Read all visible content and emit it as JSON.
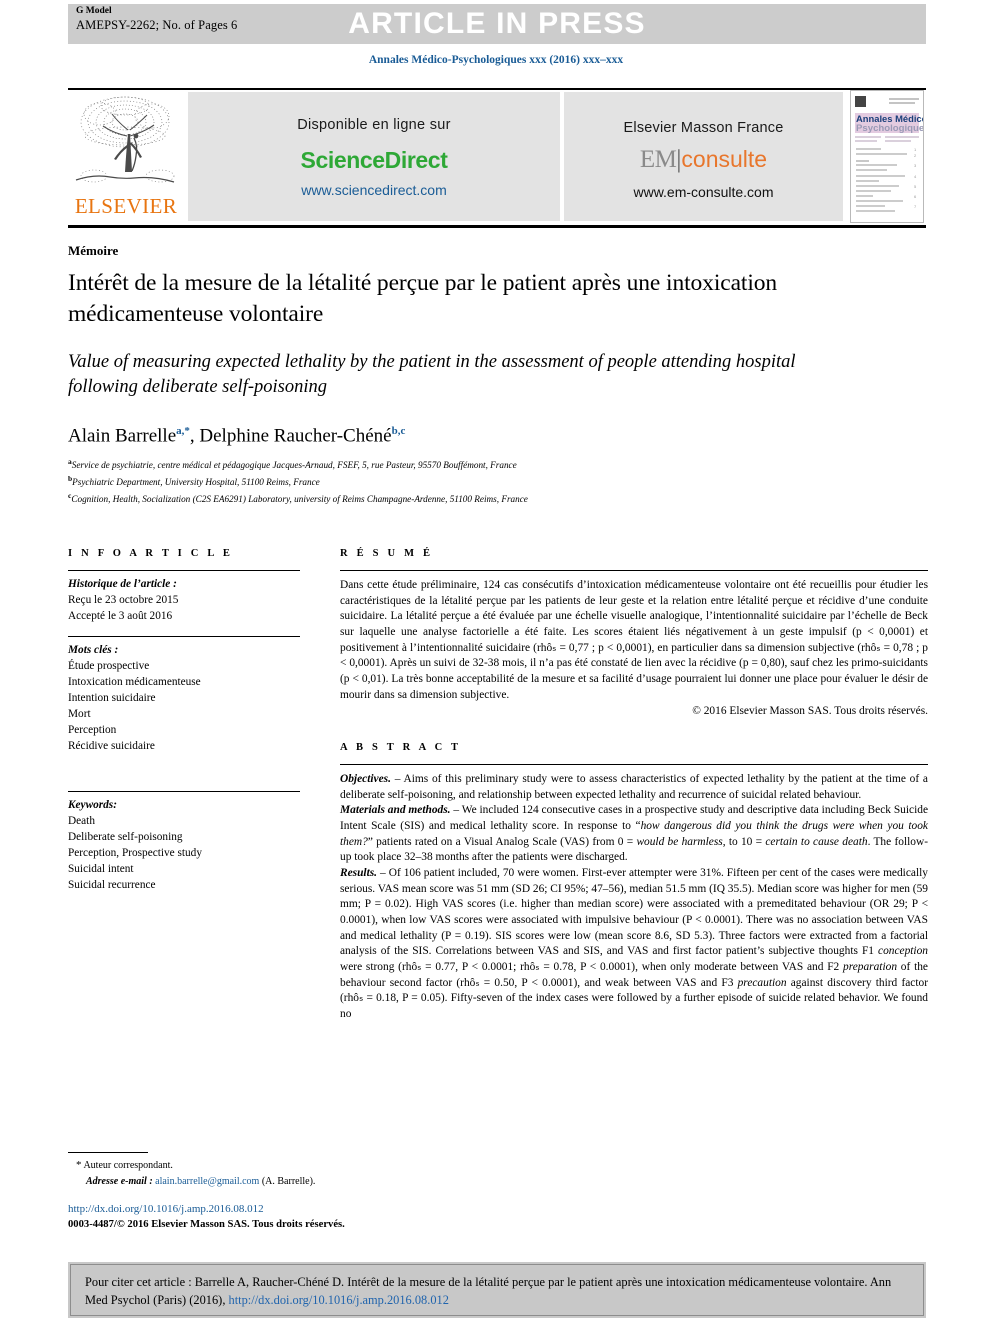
{
  "header": {
    "g_model": "G Model",
    "manuscript_id": "AMEPSY-2262; No. of Pages 6",
    "press_banner": "ARTICLE IN PRESS",
    "journal_running": "Annales Médico-Psychologiques xxx (2016) xxx–xxx"
  },
  "masthead": {
    "publisher_logo_word": "ELSEVIER",
    "sciencedirect": {
      "available_label": "Disponible en ligne sur",
      "brand": "ScienceDirect",
      "url": "www.sciencedirect.com"
    },
    "emconsulte": {
      "imprint": "Elsevier Masson France",
      "brand_em": "EM",
      "brand_divider": "|",
      "brand_consulte": "consulte",
      "url": "www.em-consulte.com"
    },
    "cover": {
      "title_line1": "Annales Médico",
      "title_line2": "Psychologiques"
    }
  },
  "article": {
    "section_label": "Mémoire",
    "title_fr": "Intérêt de la mesure de la létalité perçue par le patient après une intoxication médicamenteuse volontaire",
    "title_en": "Value of measuring expected lethality by the patient in the assessment of people attending hospital following deliberate self-poisoning",
    "authors": [
      {
        "name": "Alain Barrelle",
        "marks": "a,*"
      },
      {
        "name": "Delphine Raucher-Chéné",
        "marks": "b,c"
      }
    ],
    "affiliations": [
      {
        "mark": "a",
        "text": "Service de psychiatrie, centre médical et pédagogique Jacques-Arnaud, FSEF, 5, rue Pasteur, 95570 Bouffémont, France"
      },
      {
        "mark": "b",
        "text": "Psychiatric Department, University Hospital, 51100 Reims, France"
      },
      {
        "mark": "c",
        "text": "Cognition, Health, Socialization (C2S EA6291) Laboratory, university of Reims Champagne-Ardenne, 51100 Reims, France"
      }
    ]
  },
  "info_article": {
    "heading": "I N F O   A R T I C L E",
    "history_label": "Historique de l’article :",
    "history": [
      "Reçu le 23 octobre 2015",
      "Accepté le 3 août 2016"
    ],
    "keywords_label": "Mots clés :",
    "keywords": [
      "Étude prospective",
      "Intoxication médicamenteuse",
      "Intention suicidaire",
      "Mort",
      "Perception",
      "Récidive suicidaire"
    ],
    "keywords_en_label": "Keywords:",
    "keywords_en": [
      "Death",
      "Deliberate self-poisoning",
      "Perception, Prospective study",
      "Suicidal intent",
      "Suicidal recurrence"
    ]
  },
  "resume": {
    "heading": "R É S U M É",
    "body": "Dans cette étude préliminaire, 124 cas consécutifs d’intoxication médicamenteuse volontaire ont été recueillis pour étudier les caractéristiques de la létalité perçue par les patients de leur geste et la relation entre létalité perçue et récidive d’une conduite suicidaire. La létalité perçue a été évaluée par une échelle visuelle analogique, l’intentionnalité suicidaire par l’échelle de Beck sur laquelle une analyse factorielle a été faite. Les scores étaient liés négativement à un geste impulsif (p < 0,0001) et positivement à l’intentionnalité suicidaire (rhôₛ = 0,77 ; p < 0,0001), en particulier dans sa dimension subjective (rhôₛ = 0,78 ; p < 0,0001). Après un suivi de 32-38 mois, il n’a pas été constaté de lien avec la récidive (p = 0,80), sauf chez les primo-suicidants (p < 0,01). La très bonne acceptabilité de la mesure et sa facilité d’usage pourraient lui donner une place pour évaluer le désir de mourir dans sa dimension subjective.",
    "copyright": "© 2016 Elsevier Masson SAS. Tous droits réservés."
  },
  "abstract": {
    "heading": "A B S T R A C T",
    "objectives_label": "Objectives.",
    "objectives": "– Aims of this preliminary study were to assess characteristics of expected lethality by the patient at the time of a deliberate self-poisoning, and relationship between expected lethality and recurrence of suicidal related behaviour.",
    "methods_label": "Materials and methods.",
    "methods_part1": "– We included 124 consecutive cases in a prospective study and descriptive data including Beck Suicide Intent Scale (SIS) and medical lethality score. In response to “",
    "methods_italic1": "how dangerous did you think the drugs were when you took them?",
    "methods_part2": "” patients rated on a Visual Analog Scale (VAS) from 0 = ",
    "methods_italic2": "would be harmless",
    "methods_part3": ", to 10 = ",
    "methods_italic3": "certain to cause death",
    "methods_part4": ". The follow-up took place 32–38 months after the patients were discharged.",
    "results_label": "Results.",
    "results_part1": "– Of 106 patient included, 70 were women. First-ever attempter were 31%. Fifteen per cent of the cases were medically serious. VAS mean score was 51 mm (SD 26; CI 95%; 47–56), median 51.5 mm (IQ 35.5). Median score was higher for men (59 mm; P = 0.02). High VAS scores (i.e. higher than median score) were associated with a premeditated behaviour (OR 29; P < 0.0001), when low VAS scores were associated with impulsive behaviour (P < 0.0001). There was no association between VAS and medical lethality (P = 0.19). SIS scores were low (mean score 8.6, SD 5.3). Three factors were extracted from a factorial analysis of the SIS. Correlations between VAS and SIS, and VAS and first factor patient’s subjective thoughts F1 ",
    "results_italic1": "conception",
    "results_part2": " were strong (rhôₛ = 0.77, P < 0.0001; rhôₛ = 0.78, P < 0.0001), when only moderate between VAS and F2 ",
    "results_italic2": "preparation",
    "results_part3": " of the behaviour second factor (rhôₛ = 0.50, P < 0.0001), and weak between VAS and F3 ",
    "results_italic3": "precaution",
    "results_part4": " against discovery third factor (rhôₛ = 0.18, P = 0.05). Fifty-seven of the index cases were followed by a further episode of suicide related behavior. We found no"
  },
  "footer": {
    "corresponding_marker": "*",
    "corresponding_label": "Auteur correspondant.",
    "email_label": "Adresse e-mail :",
    "email": "alain.barrelle@gmail.com",
    "email_suffix": "(A. Barrelle).",
    "doi_url": "http://dx.doi.org/10.1016/j.amp.2016.08.012",
    "issn_copyright": "0003-4487/© 2016 Elsevier Masson SAS. Tous droits réservés."
  },
  "citation_box": {
    "text_before_link": "Pour citer cet article : Barrelle  A, Raucher-Chéné  D. Intérêt de la mesure de la létalité perçue par le patient après une intoxication médicamenteuse volontaire. Ann Med Psychol (Paris) (2016),",
    "link": "http://dx.doi.org/10.1016/j.amp.2016.08.012"
  },
  "colors": {
    "link_blue": "#1a5c96",
    "elsevier_orange": "#E87511",
    "sciencedirect_green": "#2EA836",
    "emconsulte_orange": "#E8762C",
    "banner_gray": "#cccccc",
    "panel_gray": "#e3e3e3",
    "cite_gray": "#c8c8c8"
  }
}
